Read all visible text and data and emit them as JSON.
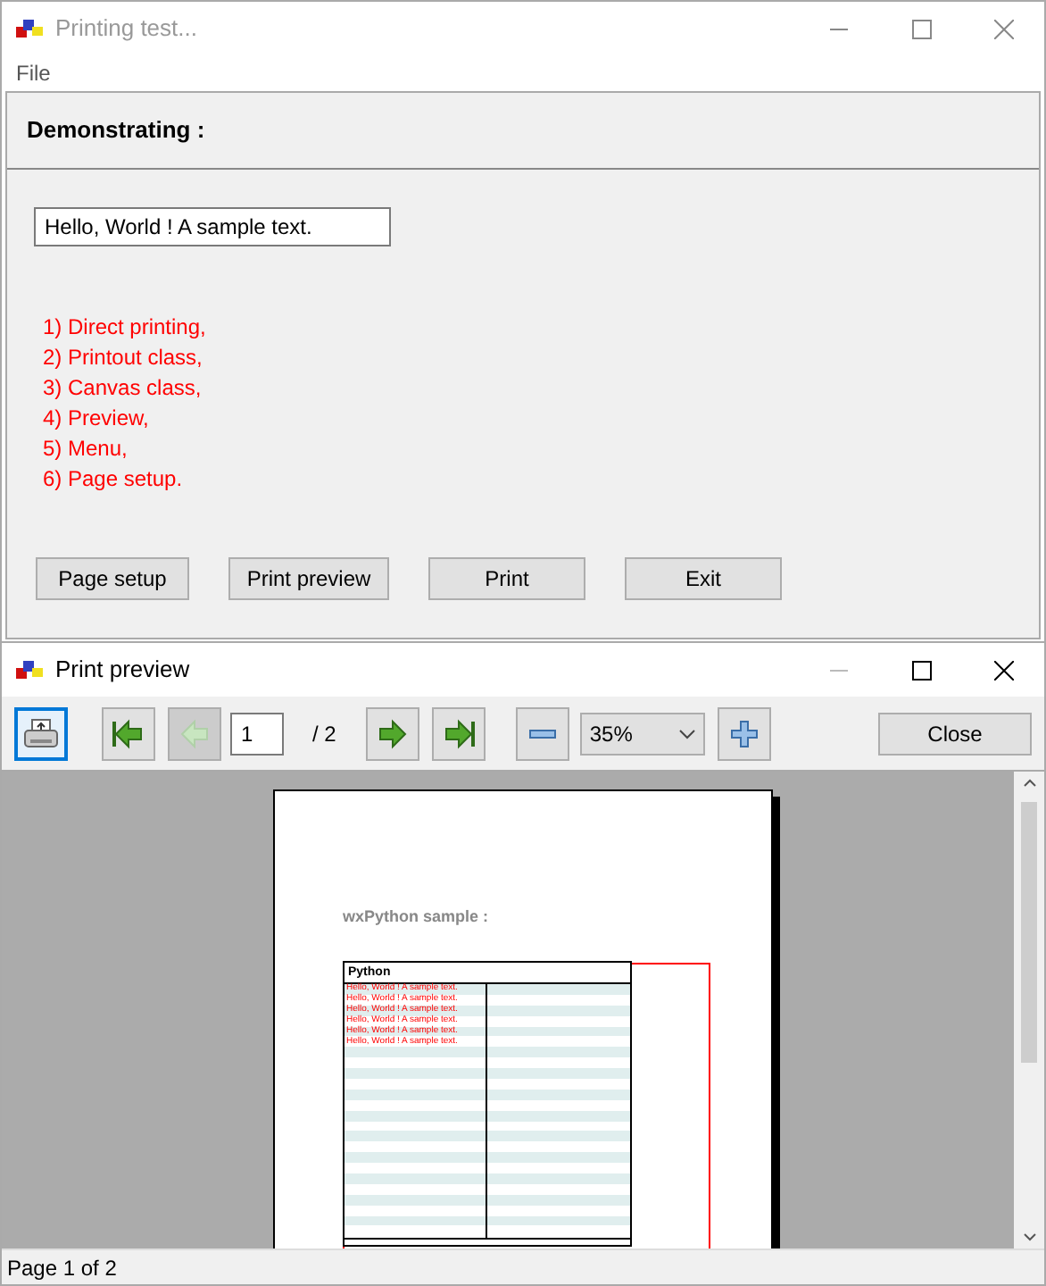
{
  "main_window": {
    "title": "Printing test...",
    "menu": [
      "File"
    ],
    "heading": "Demonstrating :",
    "text_field": {
      "value": "Hello, World ! A sample text."
    },
    "items": [
      "1) Direct printing,",
      "2) Printout class,",
      "3) Canvas class,",
      "4) Preview,",
      "5) Menu,",
      "6) Page setup."
    ],
    "buttons": [
      "Page setup",
      "Print preview",
      "Print",
      "Exit"
    ]
  },
  "preview_window": {
    "title": "Print preview",
    "toolbar": [
      {
        "kind": "print",
        "disabled": false
      },
      {
        "kind": "first",
        "disabled": false
      },
      {
        "kind": "prev",
        "disabled": true
      },
      {
        "kind": "page",
        "value": "1"
      },
      {
        "kind": "label",
        "text": "/ 2"
      },
      {
        "kind": "next",
        "disabled": false
      },
      {
        "kind": "last",
        "disabled": false
      },
      {
        "kind": "zoom_out",
        "disabled": false
      },
      {
        "kind": "zoom",
        "value": "35%"
      },
      {
        "kind": "zoom_in",
        "disabled": false
      },
      {
        "kind": "close",
        "text": "Close"
      }
    ],
    "page": {
      "heading": "wxPython sample :",
      "table_header": "Python",
      "rows": [
        "Hello, World ! A sample text.",
        "Hello, World ! A sample text.",
        "Hello, World ! A sample text.",
        "Hello, World ! A sample text.",
        "Hello, World ! A sample text.",
        "Hello, World ! A sample text."
      ]
    },
    "status_bar": "Page 1 of 2"
  }
}
